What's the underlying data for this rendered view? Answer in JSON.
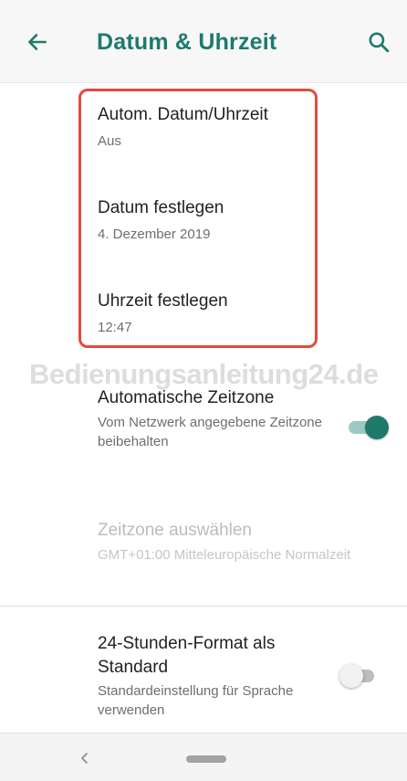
{
  "app_bar": {
    "title": "Datum & Uhrzeit"
  },
  "settings": {
    "auto_datetime": {
      "title": "Autom. Datum/Uhrzeit",
      "value": "Aus"
    },
    "set_date": {
      "title": "Datum festlegen",
      "value": "4. Dezember 2019"
    },
    "set_time": {
      "title": "Uhrzeit festlegen",
      "value": "12:47"
    },
    "auto_timezone": {
      "title": "Automatische Zeitzone",
      "description": "Vom Netzwerk angegebene Zeitzone beibehalten",
      "enabled": true
    },
    "select_timezone": {
      "title": "Zeitzone auswählen",
      "value": "GMT+01:00 Mitteleuropäische Normalzeit",
      "disabled": true
    },
    "hour24": {
      "title": "24-Stunden-Format als Standard",
      "description": "Standardeinstellung für Sprache verwenden",
      "enabled": false
    }
  },
  "watermark": "Bedienungsanleitung24.de",
  "colors": {
    "accent": "#1d7a6c",
    "highlight_border": "#e24a3f"
  },
  "icons": [
    "back-arrow-icon",
    "search-icon",
    "nav-back-icon",
    "nav-home-pill"
  ]
}
